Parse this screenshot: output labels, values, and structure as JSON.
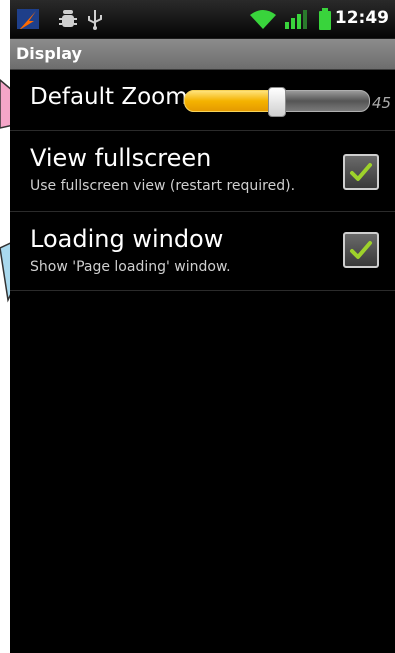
{
  "status_bar": {
    "time": "12:49",
    "icons": [
      "app-notification-icon",
      "debug-icon",
      "usb-icon",
      "wifi-icon",
      "signal-icon",
      "battery-icon"
    ]
  },
  "screen_title": "Display",
  "zoom": {
    "label": "Default Zoom",
    "value": "45",
    "level_fraction": 0.5
  },
  "preferences": [
    {
      "title": "View fullscreen",
      "summary": "Use fullscreen view (restart required).",
      "checked": true
    },
    {
      "title": "Loading window",
      "summary": "Show 'Page loading' window.",
      "checked": true
    }
  ],
  "colors": {
    "slider_fill": "#f5b300",
    "check_mark": "#9ed22b",
    "callout_pink": "#f4a6c8",
    "callout_blue": "#a9d9ee"
  }
}
